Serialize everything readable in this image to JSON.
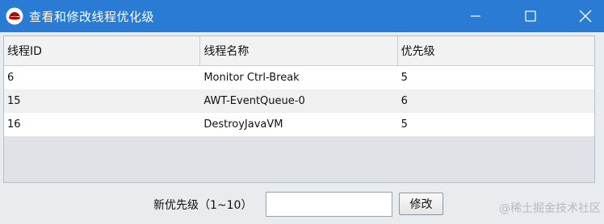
{
  "window": {
    "title": "查看和修改线程优化级",
    "icon": "redhat-icon",
    "controls": {
      "minimize_icon": "minimize-icon",
      "maximize_icon": "maximize-icon",
      "close_icon": "close-icon"
    },
    "titlebar_color": "#2a7bd4"
  },
  "table": {
    "columns": [
      "线程ID",
      "线程名称",
      "优先级"
    ],
    "rows": [
      {
        "id": "6",
        "name": "Monitor Ctrl-Break",
        "priority": "5"
      },
      {
        "id": "15",
        "name": "AWT-EventQueue-0",
        "priority": "6"
      },
      {
        "id": "16",
        "name": "DestroyJavaVM",
        "priority": "5"
      }
    ]
  },
  "form": {
    "label": "新优先级（1~10）",
    "input_value": "",
    "button_label": "修改"
  },
  "watermark": "@稀土掘金技术社区"
}
